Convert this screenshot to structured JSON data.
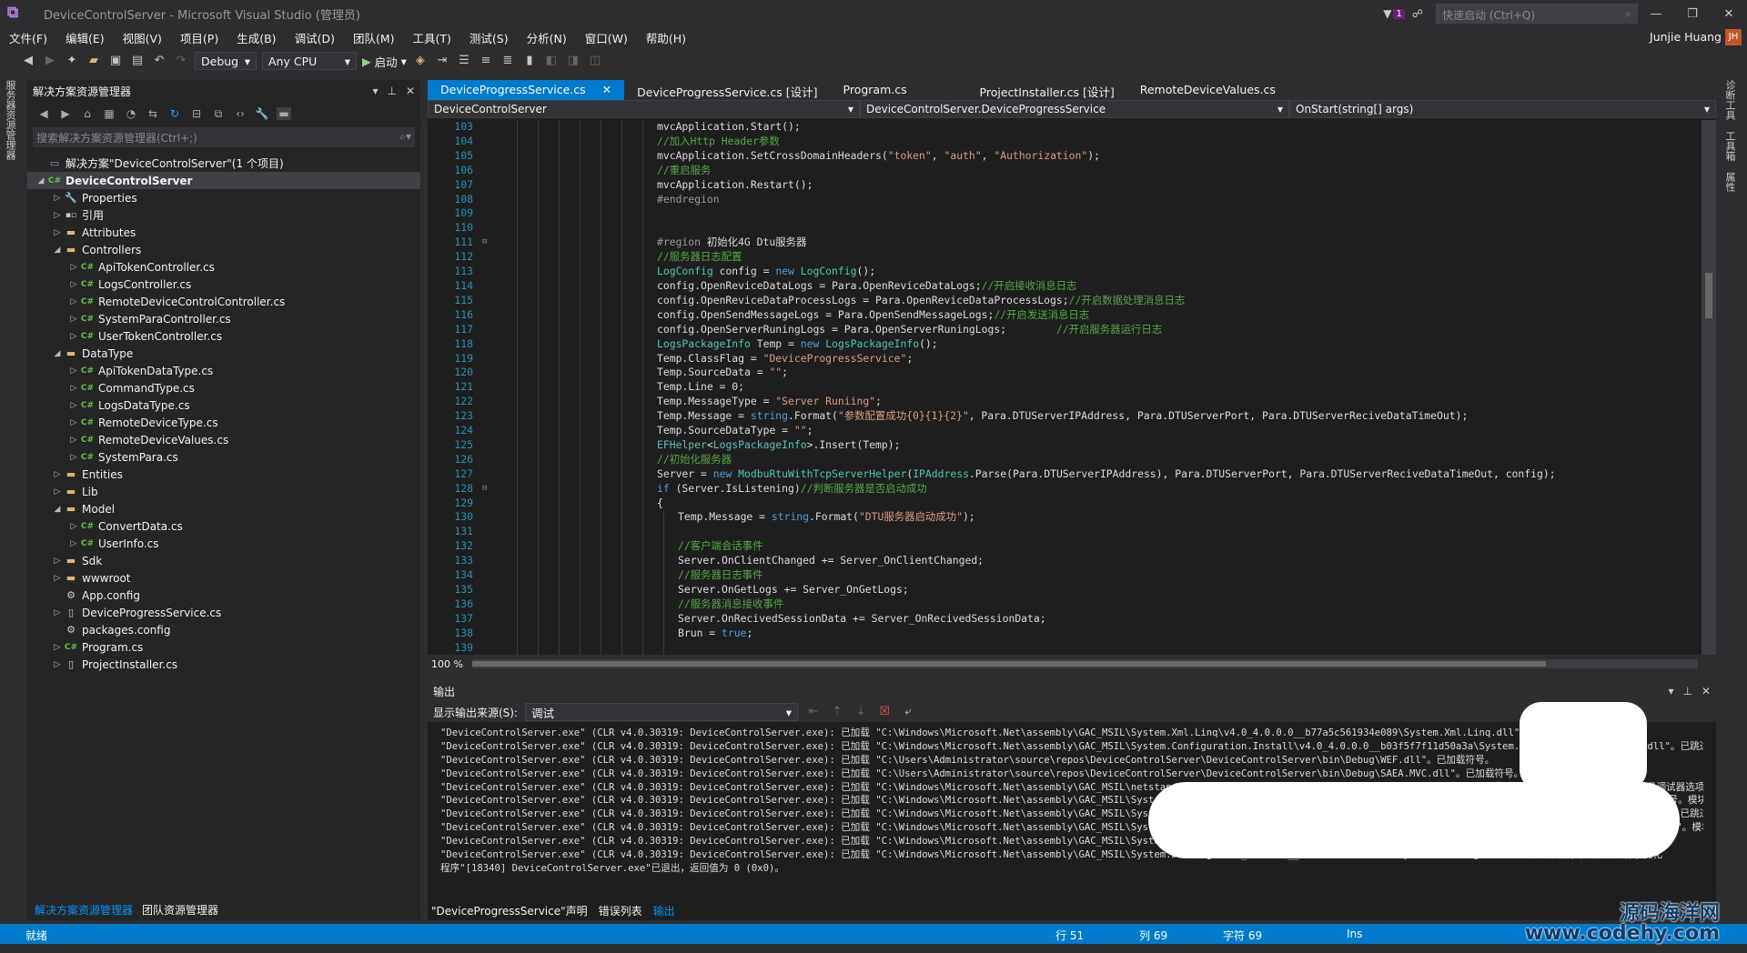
{
  "window": {
    "title": "DeviceControlServer - Microsoft Visual Studio (管理员)",
    "quick_launch": "快速启动 (Ctrl+Q)",
    "notif_count": "1"
  },
  "menu": {
    "items": [
      "文件(F)",
      "编辑(E)",
      "视图(V)",
      "项目(P)",
      "生成(B)",
      "调试(D)",
      "团队(M)",
      "工具(T)",
      "测试(S)",
      "分析(N)",
      "窗口(W)",
      "帮助(H)"
    ],
    "user": "Junjie Huang",
    "avatar": "JH"
  },
  "toolbar": {
    "config": "Debug",
    "platform": "Any CPU",
    "start": "启动"
  },
  "left_vertical_tabs": [
    "服务器资源管理器"
  ],
  "right_vertical_tabs": [
    "诊断工具",
    "工具箱",
    "属性"
  ],
  "solution_explorer": {
    "title": "解决方案资源管理器",
    "search_placeholder": "搜索解决方案资源管理器(Ctrl+;)",
    "tree": [
      {
        "label": "解决方案\"DeviceControlServer\"(1 个项目)",
        "level": 0,
        "icon": "solution",
        "arrow": ""
      },
      {
        "label": "DeviceControlServer",
        "level": 0,
        "icon": "csproj",
        "arrow": "open",
        "selected": true
      },
      {
        "label": "Properties",
        "level": 1,
        "icon": "wrench",
        "arrow": "closed"
      },
      {
        "label": "引用",
        "level": 1,
        "icon": "ref",
        "arrow": "closed"
      },
      {
        "label": "Attributes",
        "level": 1,
        "icon": "folder",
        "arrow": "closed"
      },
      {
        "label": "Controllers",
        "level": 1,
        "icon": "folder",
        "arrow": "open"
      },
      {
        "label": "ApiTokenController.cs",
        "level": 2,
        "icon": "cs",
        "arrow": "closed"
      },
      {
        "label": "LogsController.cs",
        "level": 2,
        "icon": "cs",
        "arrow": "closed"
      },
      {
        "label": "RemoteDeviceControlController.cs",
        "level": 2,
        "icon": "cs",
        "arrow": "closed"
      },
      {
        "label": "SystemParaController.cs",
        "level": 2,
        "icon": "cs",
        "arrow": "closed"
      },
      {
        "label": "UserTokenController.cs",
        "level": 2,
        "icon": "cs",
        "arrow": "closed"
      },
      {
        "label": "DataType",
        "level": 1,
        "icon": "folder",
        "arrow": "open"
      },
      {
        "label": "ApiTokenDataType.cs",
        "level": 2,
        "icon": "cs",
        "arrow": "closed"
      },
      {
        "label": "CommandType.cs",
        "level": 2,
        "icon": "cs",
        "arrow": "closed"
      },
      {
        "label": "LogsDataType.cs",
        "level": 2,
        "icon": "cs",
        "arrow": "closed"
      },
      {
        "label": "RemoteDeviceType.cs",
        "level": 2,
        "icon": "cs",
        "arrow": "closed"
      },
      {
        "label": "RemoteDeviceValues.cs",
        "level": 2,
        "icon": "cs",
        "arrow": "closed"
      },
      {
        "label": "SystemPara.cs",
        "level": 2,
        "icon": "cs",
        "arrow": "closed"
      },
      {
        "label": "Entities",
        "level": 1,
        "icon": "folder",
        "arrow": "closed"
      },
      {
        "label": "Lib",
        "level": 1,
        "icon": "folder",
        "arrow": "closed"
      },
      {
        "label": "Model",
        "level": 1,
        "icon": "folder",
        "arrow": "open"
      },
      {
        "label": "ConvertData.cs",
        "level": 2,
        "icon": "cs",
        "arrow": "closed"
      },
      {
        "label": "UserInfo.cs",
        "level": 2,
        "icon": "cs",
        "arrow": "closed"
      },
      {
        "label": "Sdk",
        "level": 1,
        "icon": "folder",
        "arrow": "closed"
      },
      {
        "label": "wwwroot",
        "level": 1,
        "icon": "folder",
        "arrow": "closed"
      },
      {
        "label": "App.config",
        "level": 1,
        "icon": "config",
        "arrow": ""
      },
      {
        "label": "DeviceProgressService.cs",
        "level": 1,
        "icon": "service",
        "arrow": "closed"
      },
      {
        "label": "packages.config",
        "level": 1,
        "icon": "config",
        "arrow": ""
      },
      {
        "label": "Program.cs",
        "level": 1,
        "icon": "cs",
        "arrow": "closed"
      },
      {
        "label": "ProjectInstaller.cs",
        "level": 1,
        "icon": "service",
        "arrow": "closed"
      }
    ],
    "bottom_tabs": [
      "解决方案资源管理器",
      "团队资源管理器"
    ]
  },
  "editor": {
    "tabs": [
      {
        "label": "DeviceProgressService.cs",
        "active": true
      },
      {
        "label": "DeviceProgressService.cs [设计]",
        "active": false
      },
      {
        "label": "Program.cs",
        "active": false
      },
      {
        "label": "ProjectInstaller.cs [设计]",
        "active": false
      },
      {
        "label": "RemoteDeviceValues.cs",
        "active": false
      }
    ],
    "nav": [
      "DeviceControlServer",
      "DeviceControlServer.DeviceProgressService",
      "OnStart(string[] args)"
    ],
    "zoom": "100 %",
    "lines": [
      {
        "n": "103",
        "indent": 0,
        "tokens": [
          [
            "t",
            "mvcApplication.Start();"
          ]
        ]
      },
      {
        "n": "104",
        "indent": 0,
        "tokens": [
          [
            "c",
            "//加入Http Header参数"
          ]
        ]
      },
      {
        "n": "105",
        "indent": 0,
        "tokens": [
          [
            "t",
            "mvcApplication.SetCrossDomainHeaders("
          ],
          [
            "s",
            "\"token\""
          ],
          [
            "t",
            ", "
          ],
          [
            "s",
            "\"auth\""
          ],
          [
            "t",
            ", "
          ],
          [
            "s",
            "\"Authorization\""
          ],
          [
            "t",
            ");"
          ]
        ]
      },
      {
        "n": "106",
        "indent": 0,
        "tokens": [
          [
            "c",
            "//重启服务"
          ]
        ]
      },
      {
        "n": "107",
        "indent": 0,
        "tokens": [
          [
            "t",
            "mvcApplication.Restart();"
          ]
        ]
      },
      {
        "n": "108",
        "indent": 0,
        "tokens": [
          [
            "p",
            "#endregion"
          ]
        ]
      },
      {
        "n": "109",
        "indent": 0,
        "tokens": []
      },
      {
        "n": "110",
        "indent": 0,
        "tokens": []
      },
      {
        "n": "111",
        "indent": 0,
        "fold": true,
        "tokens": [
          [
            "p",
            "#region "
          ],
          [
            "t",
            "初始化4G Dtu服务器"
          ]
        ]
      },
      {
        "n": "112",
        "indent": 0,
        "tokens": [
          [
            "c",
            "//服务器日志配置"
          ]
        ]
      },
      {
        "n": "113",
        "indent": 0,
        "tokens": [
          [
            "y",
            "LogConfig"
          ],
          [
            "t",
            " config = "
          ],
          [
            "k",
            "new "
          ],
          [
            "y",
            "LogConfig"
          ],
          [
            "t",
            "();"
          ]
        ]
      },
      {
        "n": "114",
        "indent": 0,
        "tokens": [
          [
            "t",
            "config.OpenReviceDataLogs = Para.OpenReviceDataLogs;"
          ],
          [
            "c",
            "//开启接收消息日志"
          ]
        ]
      },
      {
        "n": "115",
        "indent": 0,
        "tokens": [
          [
            "t",
            "config.OpenReviceDataProcessLogs = Para.OpenReviceDataProcessLogs;"
          ],
          [
            "c",
            "//开启数据处理消息日志"
          ]
        ]
      },
      {
        "n": "116",
        "indent": 0,
        "tokens": [
          [
            "t",
            "config.OpenSendMessageLogs = Para.OpenSendMessageLogs;"
          ],
          [
            "c",
            "//开启发送消息日志"
          ]
        ]
      },
      {
        "n": "117",
        "indent": 0,
        "tokens": [
          [
            "t",
            "config.OpenServerRuningLogs = Para.OpenServerRuningLogs;        "
          ],
          [
            "c",
            "//开启服务器运行日志"
          ]
        ]
      },
      {
        "n": "118",
        "indent": 0,
        "tokens": [
          [
            "y",
            "LogsPackageInfo"
          ],
          [
            "t",
            " Temp = "
          ],
          [
            "k",
            "new "
          ],
          [
            "y",
            "LogsPackageInfo"
          ],
          [
            "t",
            "();"
          ]
        ]
      },
      {
        "n": "119",
        "indent": 0,
        "tokens": [
          [
            "t",
            "Temp.ClassFlag = "
          ],
          [
            "s",
            "\"DeviceProgressService\""
          ],
          [
            "t",
            ";"
          ]
        ]
      },
      {
        "n": "120",
        "indent": 0,
        "tokens": [
          [
            "t",
            "Temp.SourceData = "
          ],
          [
            "s",
            "\"\""
          ],
          [
            "t",
            ";"
          ]
        ]
      },
      {
        "n": "121",
        "indent": 0,
        "tokens": [
          [
            "t",
            "Temp.Line = 0;"
          ]
        ]
      },
      {
        "n": "122",
        "indent": 0,
        "tokens": [
          [
            "t",
            "Temp.MessageType = "
          ],
          [
            "s",
            "\"Server Runiing\""
          ],
          [
            "t",
            ";"
          ]
        ]
      },
      {
        "n": "123",
        "indent": 0,
        "tokens": [
          [
            "t",
            "Temp.Message = "
          ],
          [
            "k",
            "string"
          ],
          [
            "t",
            ".Format("
          ],
          [
            "s",
            "\"参数配置成功{0}{1}{2}\""
          ],
          [
            "t",
            ", Para.DTUServerIPAddress, Para.DTUServerPort, Para.DTUServerReciveDataTimeOut);"
          ]
        ]
      },
      {
        "n": "124",
        "indent": 0,
        "tokens": [
          [
            "t",
            "Temp.SourceDataType = "
          ],
          [
            "s",
            "\"\""
          ],
          [
            "t",
            ";"
          ]
        ]
      },
      {
        "n": "125",
        "indent": 0,
        "tokens": [
          [
            "y",
            "EFHelper"
          ],
          [
            "t",
            "<"
          ],
          [
            "y",
            "LogsPackageInfo"
          ],
          [
            "t",
            ">.Insert(Temp);"
          ]
        ]
      },
      {
        "n": "126",
        "indent": 0,
        "tokens": [
          [
            "c",
            "//初始化服务器"
          ]
        ]
      },
      {
        "n": "127",
        "indent": 0,
        "tokens": [
          [
            "t",
            "Server = "
          ],
          [
            "k",
            "new "
          ],
          [
            "y",
            "ModbuRtuWithTcpServerHelper"
          ],
          [
            "t",
            "("
          ],
          [
            "y",
            "IPAddress"
          ],
          [
            "t",
            ".Parse(Para.DTUServerIPAddress), Para.DTUServerPort, Para.DTUServerReciveDataTimeOut, config);"
          ]
        ]
      },
      {
        "n": "128",
        "indent": 0,
        "fold": true,
        "tokens": [
          [
            "k",
            "if"
          ],
          [
            "t",
            " (Server.IsListening)"
          ],
          [
            "c",
            "//判断服务器是否启动成功"
          ]
        ]
      },
      {
        "n": "129",
        "indent": 0,
        "tokens": [
          [
            "t",
            "{"
          ]
        ]
      },
      {
        "n": "130",
        "indent": 1,
        "tokens": [
          [
            "t",
            "Temp.Message = "
          ],
          [
            "k",
            "string"
          ],
          [
            "t",
            ".Format("
          ],
          [
            "s",
            "\"DTU服务器启动成功\""
          ],
          [
            "t",
            ");"
          ]
        ]
      },
      {
        "n": "131",
        "indent": 1,
        "tokens": []
      },
      {
        "n": "132",
        "indent": 1,
        "tokens": [
          [
            "c",
            "//客户端会话事件"
          ]
        ]
      },
      {
        "n": "133",
        "indent": 1,
        "tokens": [
          [
            "t",
            "Server.OnClientChanged += Server_OnClientChanged;"
          ]
        ]
      },
      {
        "n": "134",
        "indent": 1,
        "tokens": [
          [
            "c",
            "//服务器日志事件"
          ]
        ]
      },
      {
        "n": "135",
        "indent": 1,
        "tokens": [
          [
            "t",
            "Server.OnGetLogs += Server_OnGetLogs;"
          ]
        ]
      },
      {
        "n": "136",
        "indent": 1,
        "tokens": [
          [
            "c",
            "//服务器消息接收事件"
          ]
        ]
      },
      {
        "n": "137",
        "indent": 1,
        "tokens": [
          [
            "t",
            "Server.OnRecivedSessionData += Server_OnRecivedSessionData;"
          ]
        ]
      },
      {
        "n": "138",
        "indent": 1,
        "tokens": [
          [
            "t",
            "Brun = "
          ],
          [
            "k",
            "true"
          ],
          [
            "t",
            ";"
          ]
        ]
      },
      {
        "n": "139",
        "indent": 1,
        "tokens": []
      }
    ]
  },
  "output": {
    "title": "输出",
    "source_label": "显示输出来源(S):",
    "source_value": "调试",
    "lines": [
      "\"DeviceControlServer.exe\" (CLR v4.0.30319: DeviceControlServer.exe): 已加载 \"C:\\Windows\\Microsoft.Net\\assembly\\GAC_MSIL\\System.Xml.Linq\\v4.0_4.0.0.0__b77a5c561934e089\\System.Xml.Linq.dll\"。已跳过加载符号",
      "\"DeviceControlServer.exe\" (CLR v4.0.30319: DeviceControlServer.exe): 已加载 \"C:\\Windows\\Microsoft.Net\\assembly\\GAC_MSIL\\System.Configuration.Install\\v4.0_4.0.0.0__b03f5f7f11d50a3a\\System.Configuration.Install.dll\"。已跳过加载符号。",
      "\"DeviceControlServer.exe\" (CLR v4.0.30319: DeviceControlServer.exe): 已加载 \"C:\\Users\\Administrator\\source\\repos\\DeviceControlServer\\DeviceControlServer\\bin\\Debug\\WEF.dll\"。已加载符号。",
      "\"DeviceControlServer.exe\" (CLR v4.0.30319: DeviceControlServer.exe): 已加载 \"C:\\Users\\Administrator\\source\\repos\\DeviceControlServer\\DeviceControlServer\\bin\\Debug\\SAEA.MVC.dll\"。已加载符号。",
      "\"DeviceControlServer.exe\" (CLR v4.0.30319: DeviceControlServer.exe): 已加载 \"C:\\Windows\\Microsoft.Net\\assembly\\GAC_MSIL\\netstandard\\v4.0_2.0.0.0__cc7b13ffcd2ddd51\\netstandard.dll\"。已跳过加载符号。模块进行了优化，并且调试器选项“仅我的代码”已启用。",
      "\"DeviceControlServer.exe\" (CLR v4.0.30319: DeviceControlServer.exe): 已加载 \"C:\\Windows\\Microsoft.Net\\assembly\\GAC_MSIL\\System.Runtime.Caching\\v4.0_4.0.0.0__b03f5f7f11d50a3a\\System.Runtime.Caching.dll\"。已跳过加载符号。模块进行了优化",
      "\"DeviceControlServer.exe\" (CLR v4.0.30319: DeviceControlServer.exe): 已加载 \"C:\\Windows\\Microsoft.Net\\assembly\\GAC_MSIL\\System.Runtime.Serialization\\v4.0_4.0.0.0__b77a5c561934e089\\System.Runtime.Serialization.dll\"。已跳过加载符号。",
      "\"DeviceControlServer.exe\" (CLR v4.0.30319: DeviceControlServer.exe): 已加载 \"C:\\Windows\\Microsoft.Net\\assembly\\GAC_MSIL\\System.ServiceModel.Internals\\v4.0_4.0.0.0__31bf3856ad364e35\\System.ServiceModel.Internals.dll\"。模块进行了优化",
      "\"DeviceControlServer.exe\" (CLR v4.0.30319: DeviceControlServer.exe): 已加载 \"C:\\Windows\\Microsoft.Net\\assembly\\GAC_MSIL\\System.Windows.Forms\\v4.0_4.0.0.0__b77a5c561934e089\\System.Windows.Forms.dll\"。模块进行了优化",
      "\"DeviceControlServer.exe\" (CLR v4.0.30319: DeviceControlServer.exe): 已加载 \"C:\\Windows\\Microsoft.Net\\assembly\\GAC_MSIL\\System.Drawing\\v4.0_4.0.0.0__b03f5f7f11d50a3a\\System.Drawing.dll\"。已跳过加载符号。模块进行了优化",
      "程序\"[18340] DeviceControlServer.exe\"已退出，返回值为 0 (0x0)。"
    ],
    "tabs": [
      "\"DeviceProgressService\"声明",
      "错误列表",
      "输出"
    ]
  },
  "status": {
    "ready": "就绪",
    "row": "行 51",
    "col": "列 69",
    "char": "字符 69",
    "ins": "Ins"
  },
  "watermark": {
    "line1": "源码海洋网",
    "line2": "www.codehy.com"
  }
}
